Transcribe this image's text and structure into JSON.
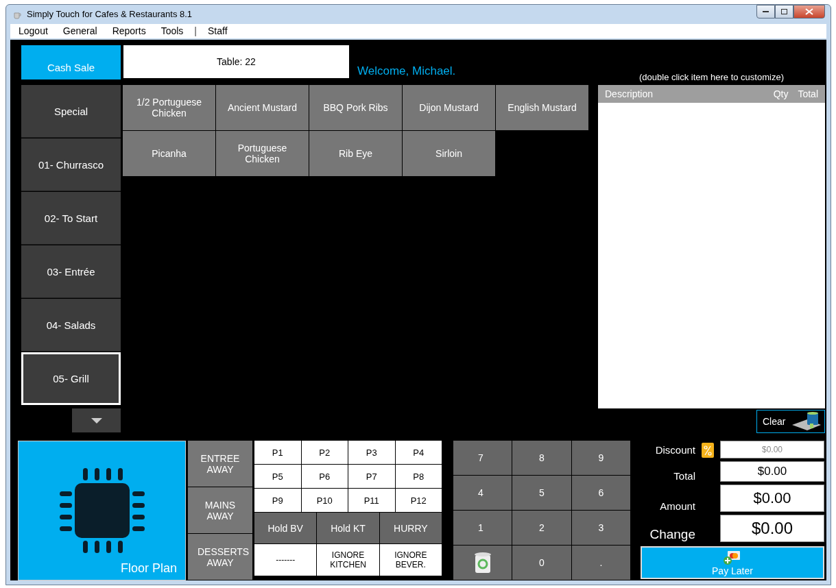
{
  "window": {
    "title": "Simply Touch for Cafes & Restaurants 8.1"
  },
  "menu": [
    {
      "label": "Logout",
      "kind": "item"
    },
    {
      "label": "General",
      "kind": "item"
    },
    {
      "label": "Reports",
      "kind": "item"
    },
    {
      "label": "Tools",
      "kind": "item"
    },
    {
      "label": "|",
      "kind": "separator"
    },
    {
      "label": "Staff",
      "kind": "item"
    }
  ],
  "cash_sale_button": "Cash Sale",
  "table_field": {
    "value": "Table: 22"
  },
  "welcome": "Welcome, Michael.",
  "order_hint": "(double click item here to customize)",
  "categories": [
    {
      "label": "Special",
      "selected": false
    },
    {
      "label": "01- Churrasco",
      "selected": false
    },
    {
      "label": "02- To Start",
      "selected": false
    },
    {
      "label": "03- Entrée",
      "selected": false
    },
    {
      "label": "04- Salads",
      "selected": false
    },
    {
      "label": "05- Grill",
      "selected": true
    }
  ],
  "items": [
    "1/2 Portuguese Chicken",
    "Ancient Mustard",
    "BBQ Pork Ribs",
    "Dijon Mustard",
    "English Mustard",
    "Picanha",
    "Portuguese Chicken",
    "Rib Eye",
    "Sirloin"
  ],
  "order": {
    "columns": [
      "Description",
      "Qty",
      "Total"
    ]
  },
  "clear_button": "Clear",
  "floor_plan_button": "Floor Plan",
  "away_buttons": [
    "ENTREE AWAY",
    "MAINS AWAY",
    "DESSERTS AWAY"
  ],
  "p_buttons": [
    "P1",
    "P2",
    "P3",
    "P4",
    "P5",
    "P6",
    "P7",
    "P8",
    "P9",
    "P10",
    "P11",
    "P12"
  ],
  "hold_buttons": [
    "Hold BV",
    "Hold KT",
    "HURRY"
  ],
  "ignore_buttons": [
    "-------",
    "IGNORE KITCHEN",
    "IGNORE BEVER."
  ],
  "numpad": [
    {
      "kind": "key",
      "label": "7"
    },
    {
      "kind": "key",
      "label": "8"
    },
    {
      "kind": "key",
      "label": "9"
    },
    {
      "kind": "key",
      "label": "4"
    },
    {
      "kind": "key",
      "label": "5"
    },
    {
      "kind": "key",
      "label": "6"
    },
    {
      "kind": "key",
      "label": "1"
    },
    {
      "kind": "key",
      "label": "2"
    },
    {
      "kind": "key",
      "label": "3"
    },
    {
      "kind": "trash"
    },
    {
      "kind": "key",
      "label": "0"
    },
    {
      "kind": "key",
      "label": "."
    }
  ],
  "totals": [
    {
      "kind": "discount",
      "label": "Discount",
      "placeholder": "$0.00"
    },
    {
      "kind": "plain",
      "label": "Total",
      "value": "$0.00"
    },
    {
      "kind": "plain",
      "label": "Amount",
      "value": "$0.00"
    },
    {
      "kind": "plain",
      "label": "Change",
      "value": "$0.00"
    }
  ],
  "pay_later_button": "Pay Later"
}
